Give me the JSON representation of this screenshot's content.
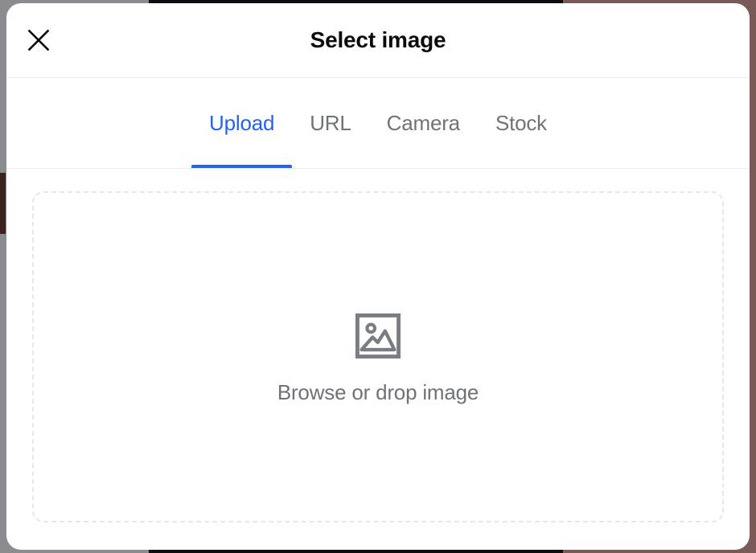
{
  "backdrop": {
    "bands": [
      {
        "name": "gray-band",
        "color": "#8c8c90"
      },
      {
        "name": "dark-band",
        "color": "#0d0d11"
      },
      {
        "name": "maroon-band",
        "color": "#7a5a56"
      }
    ],
    "accent_color": "#3a2320"
  },
  "modal": {
    "header": {
      "title": "Select image",
      "close_icon": "close-icon",
      "border_color": "#ececec"
    },
    "tabs": [
      {
        "label": "Upload",
        "active": true
      },
      {
        "label": "URL",
        "active": false
      },
      {
        "label": "Camera",
        "active": false
      },
      {
        "label": "Stock",
        "active": false
      }
    ],
    "tab_active_color": "#2563eb",
    "tab_inactive_color": "#6f7277",
    "dropzone": {
      "icon": "image-placeholder-icon",
      "label": "Browse or drop image",
      "border_color": "#e7e7e8",
      "text_color": "#6f7277"
    }
  }
}
